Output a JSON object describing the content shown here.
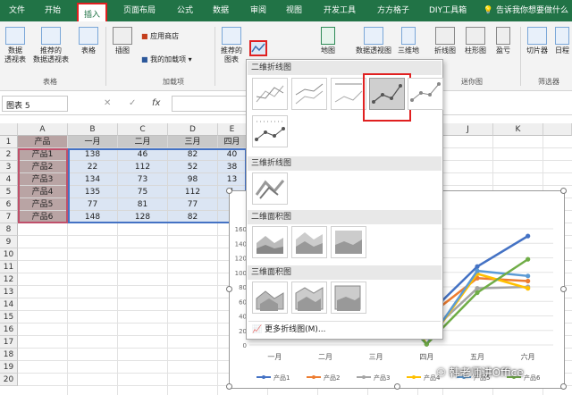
{
  "ribbon_tabs": [
    "文件",
    "开始",
    "插入",
    "页面布局",
    "公式",
    "数据",
    "审阅",
    "视图",
    "开发工具",
    "方方格子",
    "DIY工具箱"
  ],
  "tell_me": "告诉我你想要做什么",
  "ribbon": {
    "pivot": "数据\n透视表",
    "rec_pivot": "推荐的\n数据透视表",
    "table": "表格",
    "group_tables": "表格",
    "illustrations": "插图",
    "app_store": "应用商店",
    "my_addins": "我的加载项",
    "group_addins": "加载项",
    "rec_charts": "推荐的\n图表",
    "map": "地图",
    "pivot_chart": "数据透视图",
    "map3d": "三维地",
    "line": "折线图",
    "column": "柱形图",
    "winloss": "盈亏",
    "group_sparklines": "迷你图",
    "slicer": "切片器",
    "timeline": "日程",
    "group_filter": "筛选器"
  },
  "formula_bar": {
    "name_box": "图表 5",
    "cancel": "✕",
    "enter": "✓",
    "fx": "fx"
  },
  "columns": [
    "A",
    "B",
    "C",
    "D",
    "E",
    "J",
    "K"
  ],
  "rows": [
    "1",
    "2",
    "3",
    "4",
    "5",
    "6",
    "7",
    "8",
    "9",
    "10",
    "11",
    "12",
    "13",
    "14",
    "15",
    "16",
    "17",
    "18",
    "19",
    "20"
  ],
  "table": {
    "header": [
      "产品",
      "一月",
      "二月",
      "三月",
      "四月"
    ],
    "rows": [
      [
        "产品1",
        "138",
        "46",
        "82",
        "40"
      ],
      [
        "产品2",
        "22",
        "112",
        "52",
        "38"
      ],
      [
        "产品3",
        "134",
        "73",
        "98",
        "13"
      ],
      [
        "产品4",
        "135",
        "75",
        "112",
        "1"
      ],
      [
        "产品5",
        "77",
        "81",
        "77",
        "1"
      ],
      [
        "产品6",
        "148",
        "128",
        "82",
        "1"
      ]
    ]
  },
  "dropdown": {
    "sec_2d_line": "二维折线图",
    "sec_3d_line": "三维折线图",
    "sec_2d_area": "二维面积图",
    "sec_3d_area": "三维面积图",
    "more": "更多折线图(M)..."
  },
  "watermark": "韩老师讲Office",
  "colors": {
    "excel_green": "#217346",
    "selection_red": "#e02020",
    "dropdown_border": "#a8a8a8"
  },
  "chart_data": {
    "type": "line",
    "categories": [
      "一月",
      "二月",
      "三月",
      "四月",
      "五月",
      "六月"
    ],
    "y_tick_labels": [
      "0",
      "20",
      "40",
      "60",
      "80",
      "100",
      "120",
      "140",
      "160"
    ],
    "ylim": [
      0,
      160
    ],
    "series": [
      {
        "name": "产品1",
        "color": "#4472c4",
        "values": [
          138,
          46,
          82,
          40,
          108,
          150
        ]
      },
      {
        "name": "产品2",
        "color": "#ed7d31",
        "values": [
          22,
          112,
          52,
          38,
          92,
          88
        ]
      },
      {
        "name": "产品3",
        "color": "#a5a5a5",
        "values": [
          134,
          73,
          98,
          13,
          78,
          80
        ]
      },
      {
        "name": "产品4",
        "color": "#ffc000",
        "values": [
          135,
          75,
          112,
          1,
          98,
          78
        ]
      },
      {
        "name": "产品5",
        "color": "#5b9bd5",
        "values": [
          77,
          81,
          77,
          1,
          102,
          95
        ]
      },
      {
        "name": "产品6",
        "color": "#70ad47",
        "values": [
          148,
          128,
          82,
          1,
          72,
          118
        ]
      }
    ]
  }
}
